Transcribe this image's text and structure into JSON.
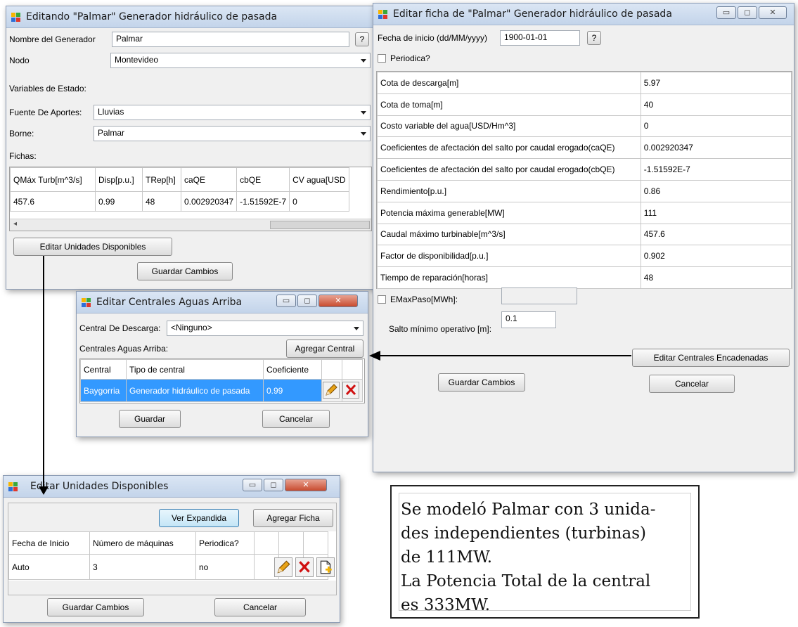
{
  "win1": {
    "title": "Editando \"Palmar\" Generador hidráulico de pasada",
    "nombre_label": "Nombre del Generador",
    "nombre_value": "Palmar",
    "help_label": "?",
    "nodo_label": "Nodo",
    "nodo_value": "Montevideo",
    "variables_label": "Variables de Estado:",
    "fuente_label": "Fuente De Aportes:",
    "fuente_value": "Lluvias",
    "borne_label": "Borne:",
    "borne_value": "Palmar",
    "fichas_label": "Fichas:",
    "table": {
      "headers": [
        "QMáx Turb[m^3/s]",
        "Disp[p.u.]",
        "TRep[h]",
        "caQE",
        "cbQE",
        "CV agua[USD"
      ],
      "row": [
        "457.6",
        "0.99",
        "48",
        "0.002920347",
        "-1.51592E-7",
        "0"
      ]
    },
    "editar_unidades_button": "Editar Unidades Disponibles",
    "guardar_button": "Guardar Cambios"
  },
  "win2": {
    "title": "Editar ficha de  \"Palmar\" Generador hidráulico de pasada",
    "fecha_label": "Fecha de inicio (dd/MM/yyyy)",
    "fecha_value": "1900-01-01",
    "help_label": "?",
    "periodica_label": "Periodica?",
    "params": [
      {
        "name": "Cota de descarga[m]",
        "value": "5.97"
      },
      {
        "name": "Cota de toma[m]",
        "value": "40"
      },
      {
        "name": "Costo variable del agua[USD/Hm^3]",
        "value": "0"
      },
      {
        "name": "Coeficientes de afectación del salto por caudal erogado(caQE)",
        "value": "0.002920347"
      },
      {
        "name": "Coeficientes de afectación del salto por caudal erogado(cbQE)",
        "value": "-1.51592E-7"
      },
      {
        "name": "Rendimiento[p.u.]",
        "value": "0.86"
      },
      {
        "name": "Potencia máxima generable[MW]",
        "value": "111"
      },
      {
        "name": "Caudal máximo turbinable[m^3/s]",
        "value": "457.6"
      },
      {
        "name": "Factor de disponibilidad[p.u.]",
        "value": "0.902"
      },
      {
        "name": "Tiempo de reparación[horas]",
        "value": "48"
      }
    ],
    "emax_label": "EMaxPaso[MWh]:",
    "salto_label": "Salto mínimo operativo [m]:",
    "salto_value": "0.1",
    "encadenadas_button": "Editar Centrales Encadenadas",
    "guardar_button": "Guardar Cambios",
    "cancelar_button": "Cancelar"
  },
  "win3": {
    "title": "Editar Centrales Aguas Arriba",
    "descarga_label": "Central De Descarga:",
    "descarga_value": "<Ninguno>",
    "aguas_arriba_label": "Centrales Aguas Arriba:",
    "agregar_button": "Agregar Central",
    "headers": [
      "Central",
      "Tipo de central",
      "Coeficiente"
    ],
    "row": [
      "Baygorria",
      "Generador hidráulico de pasada",
      "0.99"
    ],
    "guardar_button": "Guardar",
    "cancelar_button": "Cancelar"
  },
  "win4": {
    "title": "Editar Unidades Disponibles",
    "ver_button": "Ver Expandida",
    "agregar_button": "Agregar Ficha",
    "headers": [
      "Fecha de Inicio",
      "Número de máquinas",
      "Periodica?"
    ],
    "row": [
      "Auto",
      "3",
      "no"
    ],
    "guardar_button": "Guardar Cambios",
    "cancelar_button": "Cancelar"
  },
  "note": {
    "text": "Se modeló Palmar con 3 unida-\ndes  independientes (turbinas)\nde 111MW.\nLa Potencia Total de la central\nes 333MW."
  },
  "colors": {
    "selection": "#3399ff",
    "edit_icon": "#e8a317",
    "delete_icon": "#d01010"
  },
  "icons": [
    "app-icon",
    "help-icon",
    "dropdown-arrow-icon",
    "edit-pencil-icon",
    "delete-x-icon",
    "add-document-icon",
    "minimize-icon",
    "maximize-icon",
    "close-icon"
  ]
}
